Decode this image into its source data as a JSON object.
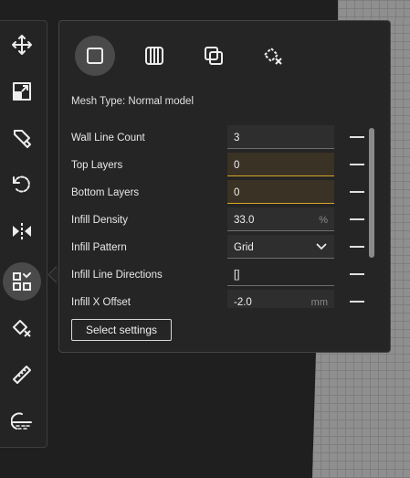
{
  "colors": {
    "panel_bg": "#252525",
    "override_border": "#d9a528",
    "active_tool_bg": "#4a4a4a"
  },
  "toolbar": {
    "tools": [
      {
        "name": "move-icon"
      },
      {
        "name": "scale-icon"
      },
      {
        "name": "support-blocker-icon"
      },
      {
        "name": "rotate-icon"
      },
      {
        "name": "mirror-icon"
      },
      {
        "name": "per-model-settings-icon",
        "active": true
      },
      {
        "name": "support-eraser-icon"
      },
      {
        "name": "measure-icon"
      },
      {
        "name": "cut-icon"
      }
    ]
  },
  "panel": {
    "mesh_types": [
      {
        "name": "normal-model-icon",
        "active": true
      },
      {
        "name": "infill-mesh-icon"
      },
      {
        "name": "cutting-mesh-icon"
      },
      {
        "name": "support-blocker-mesh-icon"
      }
    ],
    "mesh_type_label": "Mesh Type: Normal model",
    "settings": [
      {
        "label": "Wall Line Count",
        "value": "3",
        "unit": "",
        "override": false
      },
      {
        "label": "Top Layers",
        "value": "0",
        "unit": "",
        "override": true
      },
      {
        "label": "Bottom Layers",
        "value": "0",
        "unit": "",
        "override": true
      },
      {
        "label": "Infill Density",
        "value": "33.0",
        "unit": "%",
        "override": false
      },
      {
        "label": "Infill Pattern",
        "value": "Grid",
        "unit": "",
        "override": false
      },
      {
        "label": "Infill Line Directions",
        "value": "[]",
        "unit": "",
        "override": false
      },
      {
        "label": "Infill X Offset",
        "value": "-2.0",
        "unit": "mm",
        "override": false
      }
    ],
    "select_settings_label": "Select settings"
  }
}
